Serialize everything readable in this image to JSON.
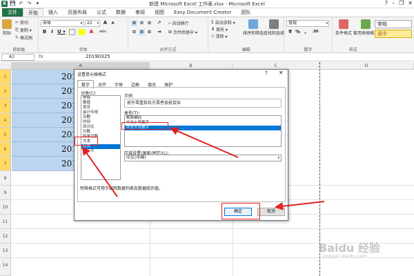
{
  "window": {
    "title": "新建 Microsoft Excel 工作表.xlsx - Microsoft Excel",
    "help": "?",
    "minimize": "–",
    "restore": "❐",
    "close": "✕"
  },
  "quick_access": [
    "X",
    "💾",
    "↶",
    "↷",
    "▾"
  ],
  "tabs": [
    "文件",
    "开始",
    "插入",
    "页面布局",
    "公式",
    "数据",
    "审阅",
    "视图",
    "Easy Document Creator",
    "团队"
  ],
  "ribbon": {
    "clipboard": {
      "label": "剪贴板",
      "paste": "粘贴",
      "cut": "剪切",
      "copy": "复制 ▾",
      "format_painter": "格式刷"
    },
    "font": {
      "label": "字体",
      "name": "宋体",
      "size": "22",
      "grow": "A",
      "shrink": "A",
      "bold": "B",
      "italic": "I",
      "underline": "U ▾",
      "color": "A",
      "wen": "wén"
    },
    "alignment": {
      "label": "对齐方式",
      "wrap": "自动换行",
      "merge": "合并后居中 ▾"
    },
    "number": {
      "label": "数字",
      "format": "常规",
      "percent": "%",
      "comma": ",",
      "inc": ".00"
    },
    "editing": {
      "label": "编辑",
      "autosum": "自动求和 ▾",
      "fill": "填充 ▾",
      "clear": "清除 ▾",
      "sort": "排序和筛选",
      "find": "查找和选择"
    },
    "styles": {
      "label": "样式",
      "conditional": "条件格式",
      "table": "套用表格格式",
      "normal": "常规",
      "medium": "适中"
    }
  },
  "formula_bar": {
    "name_box": "A1",
    "fx": "fx",
    "value": "20190325"
  },
  "columns": [
    "A",
    "B",
    "C",
    "D"
  ],
  "rows": [
    "1",
    "2",
    "3",
    "4",
    "5",
    "6",
    "7",
    "8",
    "9",
    "10",
    "11",
    "12",
    "13",
    "14"
  ],
  "cells": [
    "201",
    "201",
    "201",
    "201",
    "201",
    "201",
    "201"
  ],
  "dialog": {
    "title": "设置单元格格式",
    "help": "?",
    "close": "✕",
    "tabs": [
      "数字",
      "对齐",
      "字体",
      "边框",
      "填充",
      "保护"
    ],
    "category_label": "分类(C):",
    "categories": [
      "常规",
      "数值",
      "货币",
      "会计专用",
      "日期",
      "时间",
      "百分比",
      "分数",
      "科学记数",
      "文本",
      "特殊",
      "自定义"
    ],
    "selected_category": 10,
    "sample_label": "示例",
    "sample_value": "贰仟零壹拾玖万零叁佰贰拾伍",
    "type_label": "类型(T):",
    "types": [
      "邮政编码",
      "中文小写数字",
      "中文大写数字"
    ],
    "selected_type": 2,
    "locale_label": "区域设置(国家/地区)(L):",
    "locale": "中文(中国)",
    "description": "特殊格式可用于跟踪数据列表及数据库的值。",
    "ok": "确定",
    "cancel": "取消"
  },
  "watermark": {
    "brand": "Baidu 经验",
    "url": "jingyan.baidu.com"
  }
}
